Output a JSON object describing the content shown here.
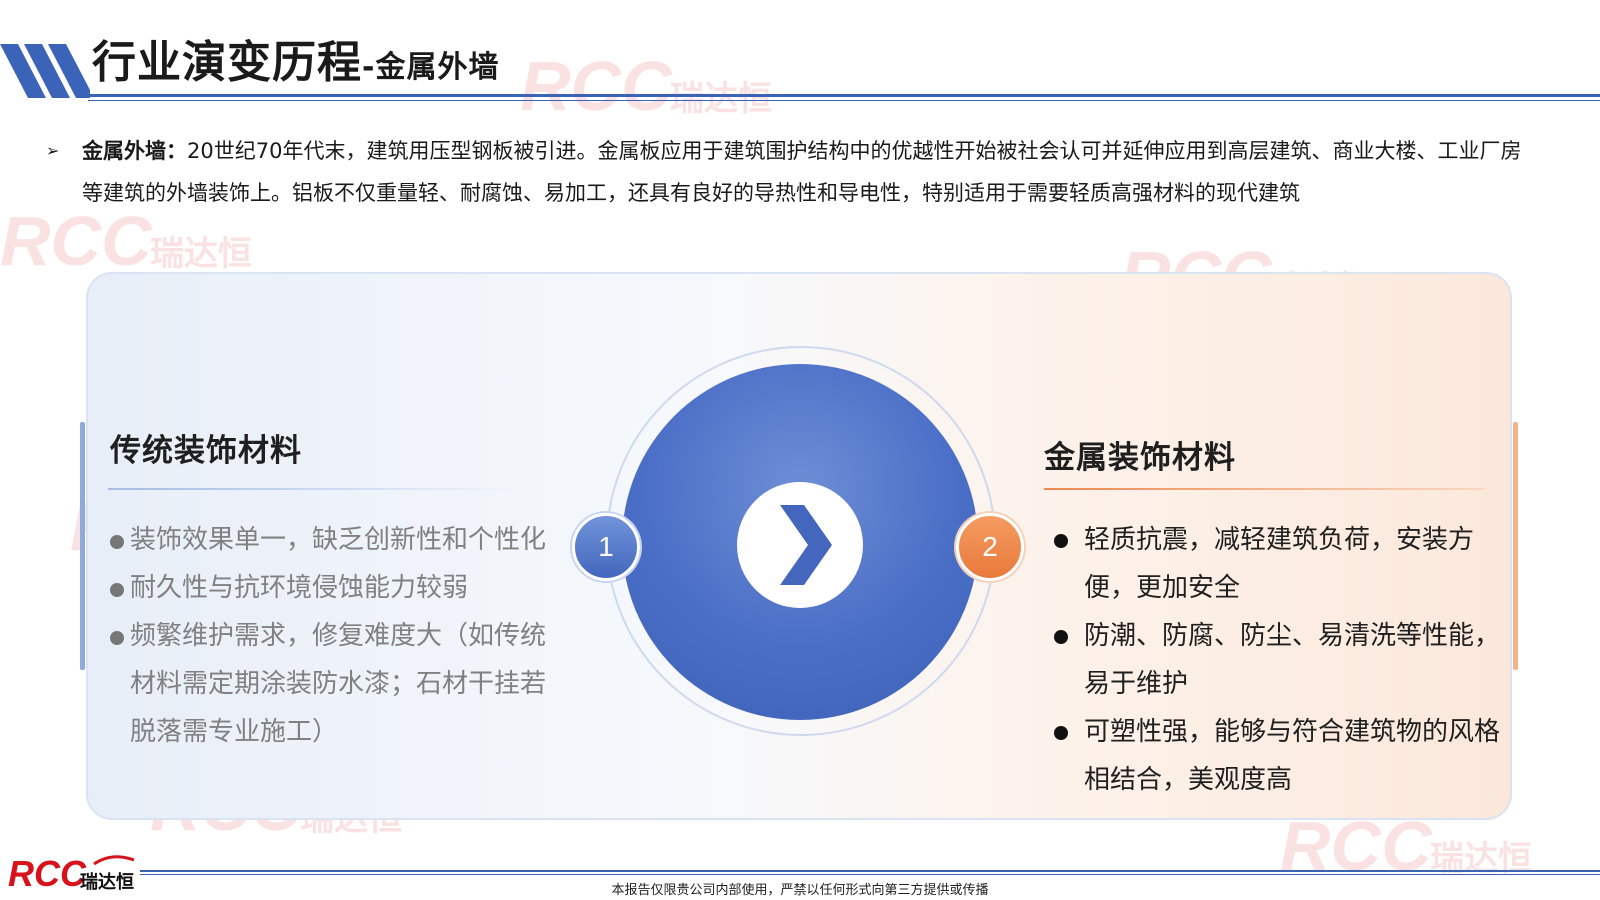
{
  "header": {
    "title_main": "行业演变历程",
    "title_sub": "-金属外墙"
  },
  "intro": {
    "bullet_glyph": "➢",
    "label": "金属外墙：",
    "text": "20世纪70年代末，建筑用压型钢板被引进。金属板应用于建筑围护结构中的优越性开始被社会认可并延伸应用到高层建筑、商业大楼、工业厂房等建筑的外墙装饰上。铝板不仅重量轻、耐腐蚀、易加工，还具有良好的导热性和导电性，特别适用于需要轻质高强材料的现代建筑"
  },
  "comparison": {
    "left": {
      "badge": "1",
      "title": "传统装饰材料",
      "items": [
        "装饰效果单一，缺乏创新性和个性化",
        "耐久性与抗环境侵蚀能力较弱",
        "频繁维护需求，修复难度大（如传统材料需定期涂装防水漆；石材干挂若脱落需专业施工）"
      ]
    },
    "right": {
      "badge": "2",
      "title": "金属装饰材料",
      "items": [
        "轻质抗震，减轻建筑负荷，安装方便，更加安全",
        "防潮、防腐、防尘、易清洗等性能，易于维护",
        "可塑性强，能够与符合建筑物的风格相结合，美观度高"
      ]
    },
    "center_icon": "chevron-right-icon"
  },
  "footer": {
    "logo_text": "RCC",
    "logo_cn": "瑞达恒",
    "disclaimer": "本报告仅限贵公司内部使用，严禁以任何形式向第三方提供或传播"
  },
  "watermark": {
    "text": "RCC",
    "cn": "瑞达恒"
  },
  "colors": {
    "brand_blue": "#3b64b9",
    "accent_orange": "#e87a3b",
    "logo_red": "#d8121b"
  }
}
